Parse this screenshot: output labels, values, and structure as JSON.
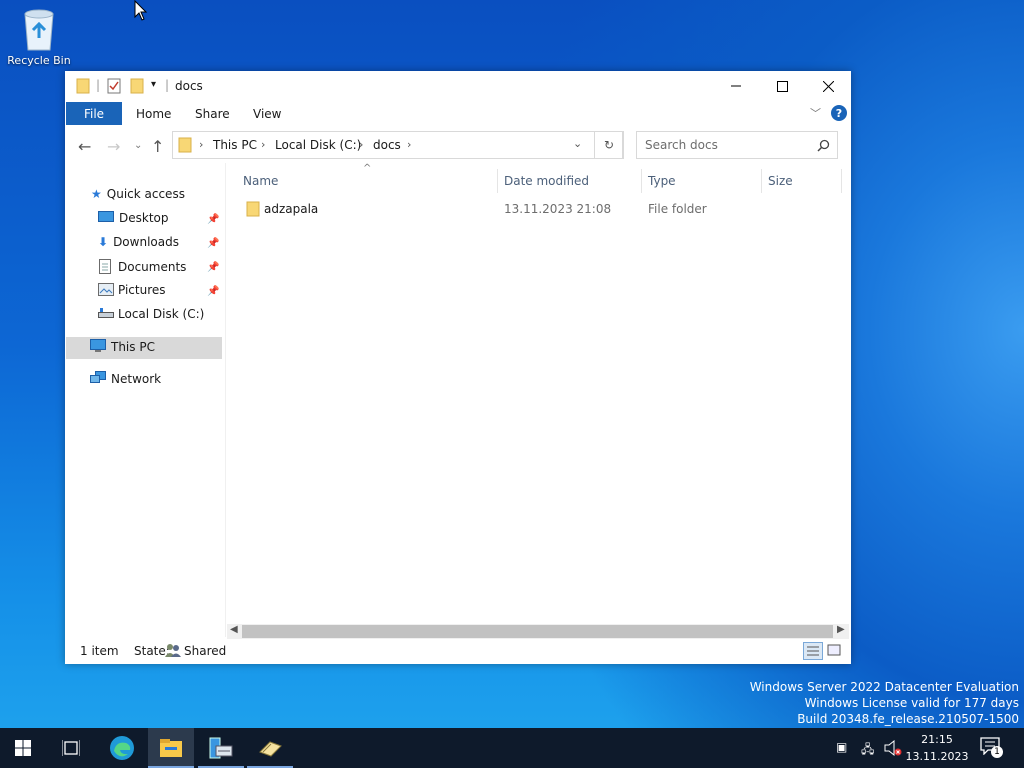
{
  "desktop": {
    "recycle_bin_label": "Recycle Bin"
  },
  "window": {
    "title": "docs",
    "ribbon_tabs": {
      "file": "File",
      "home": "Home",
      "share": "Share",
      "view": "View"
    },
    "address": {
      "crumbs": [
        "This PC",
        "Local Disk (C:)",
        "docs"
      ]
    },
    "search": {
      "placeholder": "Search docs"
    },
    "nav": {
      "quick_access": "Quick access",
      "desktop": "Desktop",
      "downloads": "Downloads",
      "documents": "Documents",
      "pictures": "Pictures",
      "local_disk": "Local Disk (C:)",
      "this_pc": "This PC",
      "network": "Network"
    },
    "columns": {
      "name": "Name",
      "date": "Date modified",
      "type": "Type",
      "size": "Size"
    },
    "files": [
      {
        "name": "adzapala",
        "date": "13.11.2023 21:08",
        "type": "File folder",
        "size": ""
      }
    ],
    "status": {
      "count": "1 item",
      "state_label": "State:",
      "state_value": "Shared"
    }
  },
  "watermark": {
    "line1": "Windows Server 2022 Datacenter Evaluation",
    "line2": "Windows License valid for 177 days",
    "line3": "Build 20348.fe_release.210507-1500"
  },
  "taskbar": {
    "time": "21:15",
    "date": "13.11.2023",
    "notification_count": "1"
  }
}
